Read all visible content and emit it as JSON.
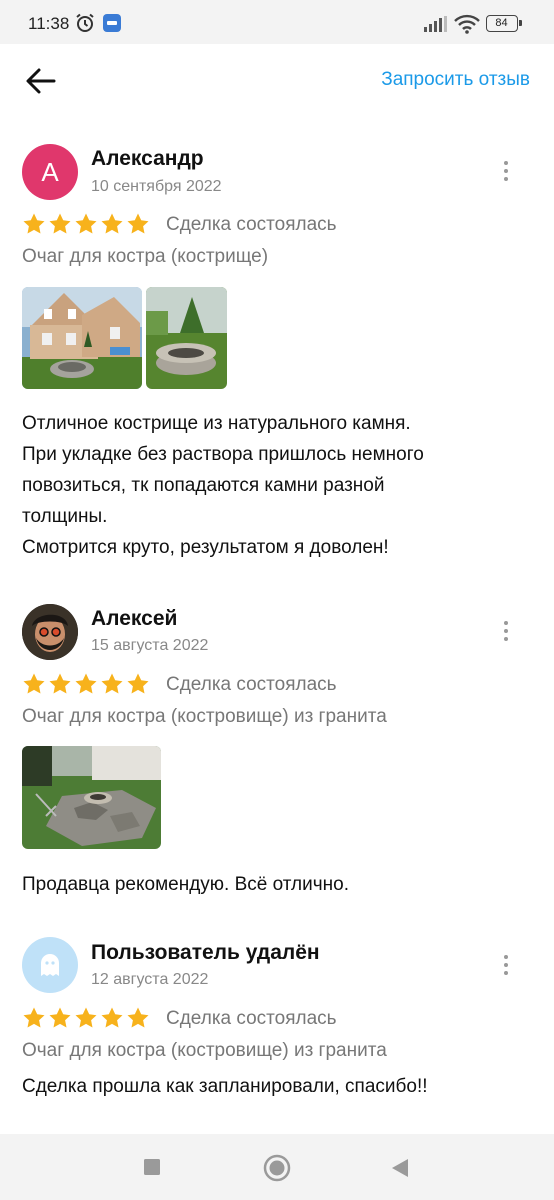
{
  "status_bar": {
    "time": "11:38",
    "battery": "84",
    "icons": [
      "alarm-icon",
      "app-notification-icon",
      "signal-icon",
      "wifi-icon",
      "battery-icon"
    ]
  },
  "header": {
    "back_icon": "arrow-left-icon",
    "request_review": "Запросить отзыв"
  },
  "reviews": [
    {
      "author": "Александр",
      "avatar_letter": "А",
      "avatar_color": "#e0376c",
      "date": "10 сентября 2022",
      "rating": 5,
      "deal_status": "Сделка состоялась",
      "item": "Очаг для костра (кострище)",
      "photos": 2,
      "text_lines": [
        "Отличное кострище из натурального камня.",
        "При укладке без раствора пришлось немного",
        "повозиться, тк попадаются камни разной",
        "толщины.",
        "Смотрится круто, результатом я доволен!"
      ]
    },
    {
      "author": "Алексей",
      "date": "15 августа 2022",
      "rating": 5,
      "deal_status": "Сделка состоялась",
      "item": "Очаг для костра (костровище) из гранита",
      "photos": 1,
      "text": "Продавца рекомендую. Всё отлично."
    },
    {
      "author": "Пользователь удалён",
      "avatar_color": "#bfe1f8",
      "avatar_icon": "ghost-icon",
      "date": "12 августа 2022",
      "rating": 5,
      "deal_status": "Сделка состоялась",
      "item": "Очаг для костра (костровище) из гранита",
      "text": "Сделка прошла как запланировали, спасибо!!"
    }
  ],
  "colors": {
    "accent": "#1b9ae8",
    "star": "#f7b21c",
    "muted_text": "#777777"
  },
  "nav_bar": {
    "icons": [
      "square-icon",
      "home-circle-icon",
      "back-triangle-icon"
    ]
  }
}
